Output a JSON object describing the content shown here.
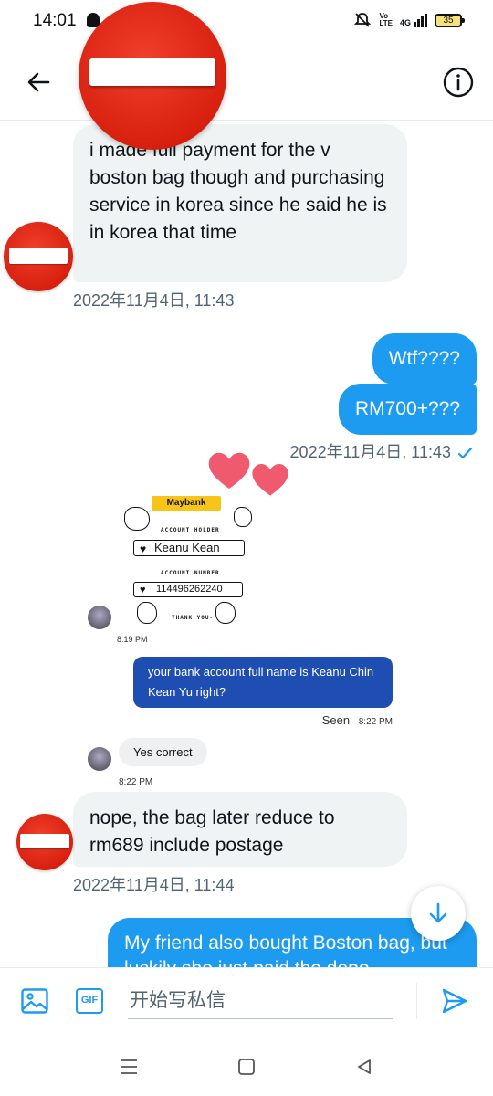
{
  "status_bar": {
    "time": "14:01",
    "volte_label": "Vo\nLTE",
    "network_label": "4G",
    "battery": "35"
  },
  "header": {
    "back_icon": "arrow-left-icon",
    "info_icon": "info-circle-icon",
    "avatar": "no-entry-sign-avatar"
  },
  "messages": [
    {
      "direction": "incoming",
      "text": "i made full payment for the v boston bag though and purchasing service in korea since he said he is in korea that time",
      "timestamp": "2022年11月4日, 11:43"
    },
    {
      "direction": "outgoing",
      "text": "Wtf????"
    },
    {
      "direction": "outgoing",
      "text": "RM700+???",
      "timestamp": "2022年11月4日, 11:43",
      "read_icon": "checkmark-icon"
    },
    {
      "direction": "outgoing",
      "type": "image",
      "embedded": {
        "bank_logo": "Maybank",
        "account_holder_label": "ACCOUNT HOLDER",
        "account_holder": "Keanu Kean",
        "account_number_label": "ACCOUNT NUMBER",
        "account_number": "114496262240",
        "thanks": "THANK YOU-",
        "time_1": "8:19 PM",
        "question": "your bank account full name is Keanu Chin Kean Yu right?",
        "seen": "Seen",
        "seen_time": "8:22 PM",
        "reply": "Yes correct",
        "time_2": "8:22 PM"
      }
    },
    {
      "direction": "incoming",
      "text": "nope, the bag later reduce to rm689 include postage",
      "timestamp": "2022年11月4日, 11:44"
    },
    {
      "direction": "outgoing",
      "text": "My friend also bought Boston bag, but luckily she just paid the depo"
    }
  ],
  "composer": {
    "placeholder": "开始写私信",
    "gallery_icon": "image-icon",
    "gif_label": "GIF",
    "send_icon": "send-icon"
  },
  "colors": {
    "accent": "#1d9bf0",
    "incoming_bubble": "#eff3f4",
    "timestamp": "#536471",
    "avatar_red": "#d8200f"
  }
}
